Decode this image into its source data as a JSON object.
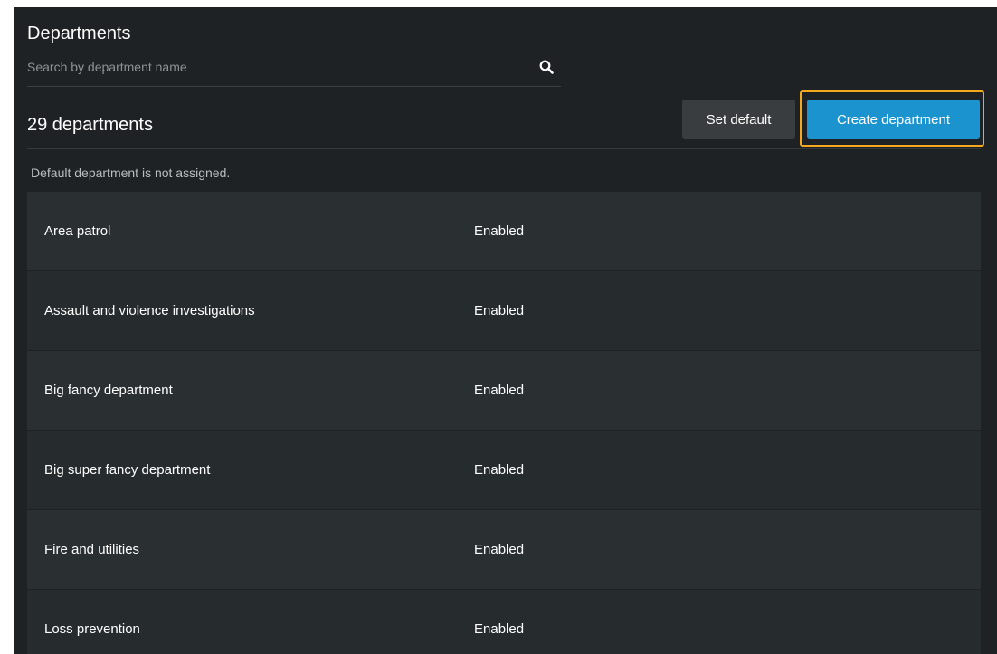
{
  "header": {
    "title": "Departments",
    "search_placeholder": "Search by department name",
    "search_icon": "magnifier"
  },
  "toolbar": {
    "count_label": "29 departments",
    "set_default_label": "Set default",
    "create_label": "Create department"
  },
  "notice": "Default department is not assigned.",
  "departments": [
    {
      "name": "Area patrol",
      "status": "Enabled"
    },
    {
      "name": "Assault and violence investigations",
      "status": "Enabled"
    },
    {
      "name": "Big fancy department",
      "status": "Enabled"
    },
    {
      "name": "Big super fancy department",
      "status": "Enabled"
    },
    {
      "name": "Fire and utilities",
      "status": "Enabled"
    },
    {
      "name": "Loss prevention",
      "status": "Enabled"
    }
  ],
  "colors": {
    "background": "#1e2224",
    "row_odd": "#2a2f31",
    "row_even": "#262b2d",
    "accent": "#1b93cf",
    "highlight": "#f4a81d"
  }
}
